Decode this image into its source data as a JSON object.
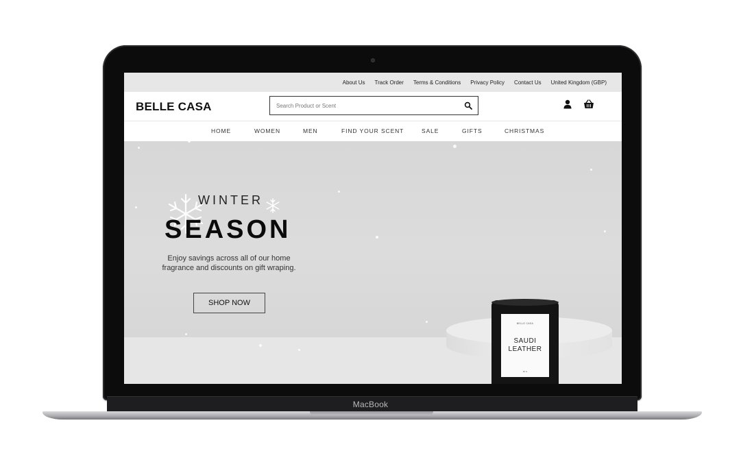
{
  "device": {
    "brand_label": "MacBook"
  },
  "site": {
    "topbar_links": [
      "About Us",
      "Track Order",
      "Terms & Conditions",
      "Privacy Policy",
      "Contact Us",
      "United Kingdom (GBP)"
    ],
    "logo": "BELLE CASA",
    "search": {
      "placeholder": "Search Product or Scent"
    },
    "icons": {
      "search": "search-icon",
      "account": "user-icon",
      "basket": "basket-icon"
    },
    "nav": [
      "HOME",
      "WOMEN",
      "MEN",
      "FIND YOUR SCENT",
      "SALE",
      "GIFTS",
      "CHRISTMAS"
    ]
  },
  "hero": {
    "eyebrow": "WINTER",
    "title": "SEASON",
    "description": "Enjoy savings across all of our home fragrance and discounts on gift wraping.",
    "cta": "SHOP NOW",
    "product": {
      "brand": "BELLE CASA",
      "name_line1": "SAUDI",
      "name_line2": "LEATHER",
      "foot": "90 G"
    }
  },
  "colors": {
    "hero_bg": "#d7d7d7",
    "text_dark": "#111111",
    "frame": "#0c0c0d"
  }
}
